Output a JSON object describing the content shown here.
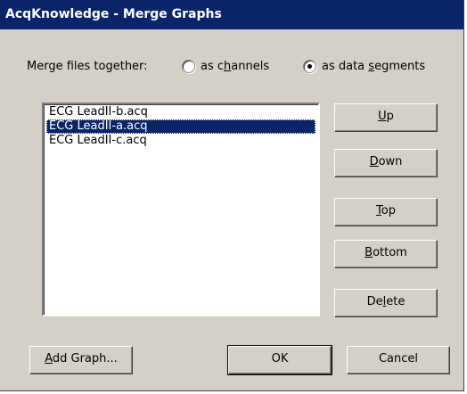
{
  "window": {
    "title": "AcqKnowledge - Merge Graphs"
  },
  "merge": {
    "label": "Merge files together:",
    "option_channels": {
      "pre": "as c",
      "key": "h",
      "post": "annels",
      "selected": false
    },
    "option_segments": {
      "pre": "as data ",
      "key": "s",
      "post": "egments",
      "selected": true
    }
  },
  "files": {
    "items": [
      {
        "label": "ECG LeadII-b.acq",
        "selected": false
      },
      {
        "label": "ECG LeadII-a.acq",
        "selected": true
      },
      {
        "label": "ECG LeadII-c.acq",
        "selected": false
      }
    ]
  },
  "buttons": {
    "up": {
      "pre": "",
      "key": "U",
      "post": "p"
    },
    "down": {
      "pre": "",
      "key": "D",
      "post": "own"
    },
    "top": {
      "pre": "",
      "key": "T",
      "post": "op"
    },
    "bottom": {
      "pre": "",
      "key": "B",
      "post": "ottom"
    },
    "delete": {
      "pre": "De",
      "key": "l",
      "post": "ete"
    },
    "add_graph": {
      "pre": "",
      "key": "A",
      "post": "dd Graph..."
    },
    "ok": {
      "label": "OK"
    },
    "cancel": {
      "label": "Cancel"
    }
  },
  "colors": {
    "face": "#d4d0c8",
    "selection": "#0a246a",
    "titlebar": "#0a246a"
  }
}
